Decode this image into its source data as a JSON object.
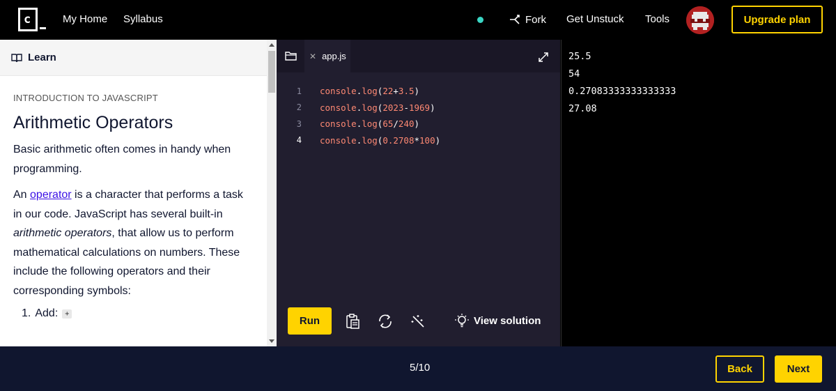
{
  "header": {
    "logo_letter": "c",
    "nav": [
      {
        "label": "My Home"
      },
      {
        "label": "Syllabus"
      }
    ],
    "fork_label": "Fork",
    "get_unstuck_label": "Get Unstuck",
    "tools_label": "Tools",
    "upgrade_label": "Upgrade plan",
    "colors": {
      "accent": "#ffd300",
      "status_dot": "#3ad6c4"
    }
  },
  "learn": {
    "header_label": "Learn",
    "kicker": "INTRODUCTION TO JAVASCRIPT",
    "title": "Arithmetic Operators",
    "para1": "Basic arithmetic often comes in handy when programming.",
    "para2_prefix": "An ",
    "para2_link": "operator",
    "para2_mid": " is a character that performs a task in our code. JavaScript has several built-in ",
    "para2_em": "arithmetic operators",
    "para2_suffix": ", that allow us to perform mathematical calculations on numbers. These include the following operators and their corresponding symbols:",
    "list": [
      {
        "number": "1.",
        "label": "Add:",
        "symbol": "+"
      }
    ]
  },
  "editor": {
    "tab_name": "app.js",
    "lines": [
      {
        "n": "1",
        "obj": "console",
        "method": "log",
        "a": "22",
        "op": "+",
        "b": "3.5"
      },
      {
        "n": "2",
        "obj": "console",
        "method": "log",
        "a": "2023",
        "op": "-",
        "b": "1969"
      },
      {
        "n": "3",
        "obj": "console",
        "method": "log",
        "a": "65",
        "op": "/",
        "b": "240"
      },
      {
        "n": "4",
        "obj": "console",
        "method": "log",
        "a": "0.2708",
        "op": "*",
        "b": "100"
      }
    ],
    "run_label": "Run",
    "view_solution_label": "View solution"
  },
  "output": {
    "lines": [
      "25.5",
      "54",
      "0.27083333333333333",
      "27.08"
    ]
  },
  "footer": {
    "progress": "5/10",
    "back_label": "Back",
    "next_label": "Next"
  }
}
